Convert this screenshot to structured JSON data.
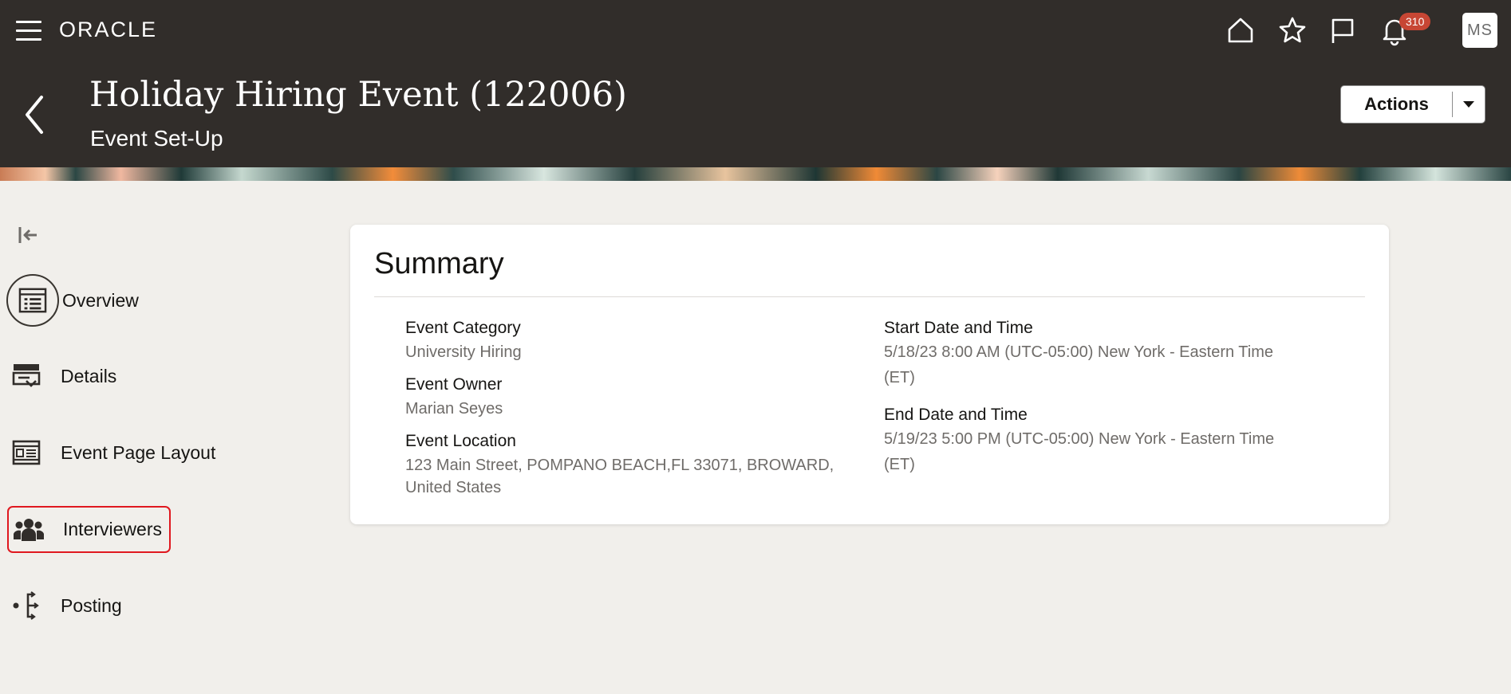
{
  "topbar": {
    "logo": "ORACLE",
    "notification_count": "310",
    "avatar_initials": "MS",
    "icons": [
      "menu-icon",
      "home-icon",
      "favorites-star-icon",
      "flag-icon",
      "notifications-bell-icon"
    ]
  },
  "header": {
    "title": "Holiday Hiring Event (122006)",
    "subtitle": "Event Set-Up",
    "actions_label": "Actions"
  },
  "sidebar": {
    "items": [
      {
        "label": "Overview",
        "icon": "overview-list-icon"
      },
      {
        "label": "Details",
        "icon": "details-icon"
      },
      {
        "label": "Event Page Layout",
        "icon": "page-layout-icon"
      },
      {
        "label": "Interviewers",
        "icon": "interviewers-group-icon",
        "highlighted": true
      },
      {
        "label": "Posting",
        "icon": "posting-icon"
      }
    ]
  },
  "summary": {
    "title": "Summary",
    "event_category_label": "Event Category",
    "event_category_value": "University Hiring",
    "event_owner_label": "Event Owner",
    "event_owner_value": "Marian Seyes",
    "event_location_label": "Event Location",
    "event_location_line1": "123 Main Street, POMPANO BEACH,FL 33071, BROWARD,",
    "event_location_line2": "United States",
    "start_label": "Start Date and Time",
    "start_line1": "5/18/23 8:00 AM (UTC-05:00) New York - Eastern Time",
    "start_line2": "(ET)",
    "end_label": "End Date and Time",
    "end_line1": "5/19/23 5:00 PM (UTC-05:00) New York - Eastern Time",
    "end_line2": "(ET)"
  },
  "colors": {
    "header_bg": "#312d2a",
    "badge": "#c74634",
    "highlight_border": "#e0181f",
    "page_bg": "#f1efeb"
  }
}
